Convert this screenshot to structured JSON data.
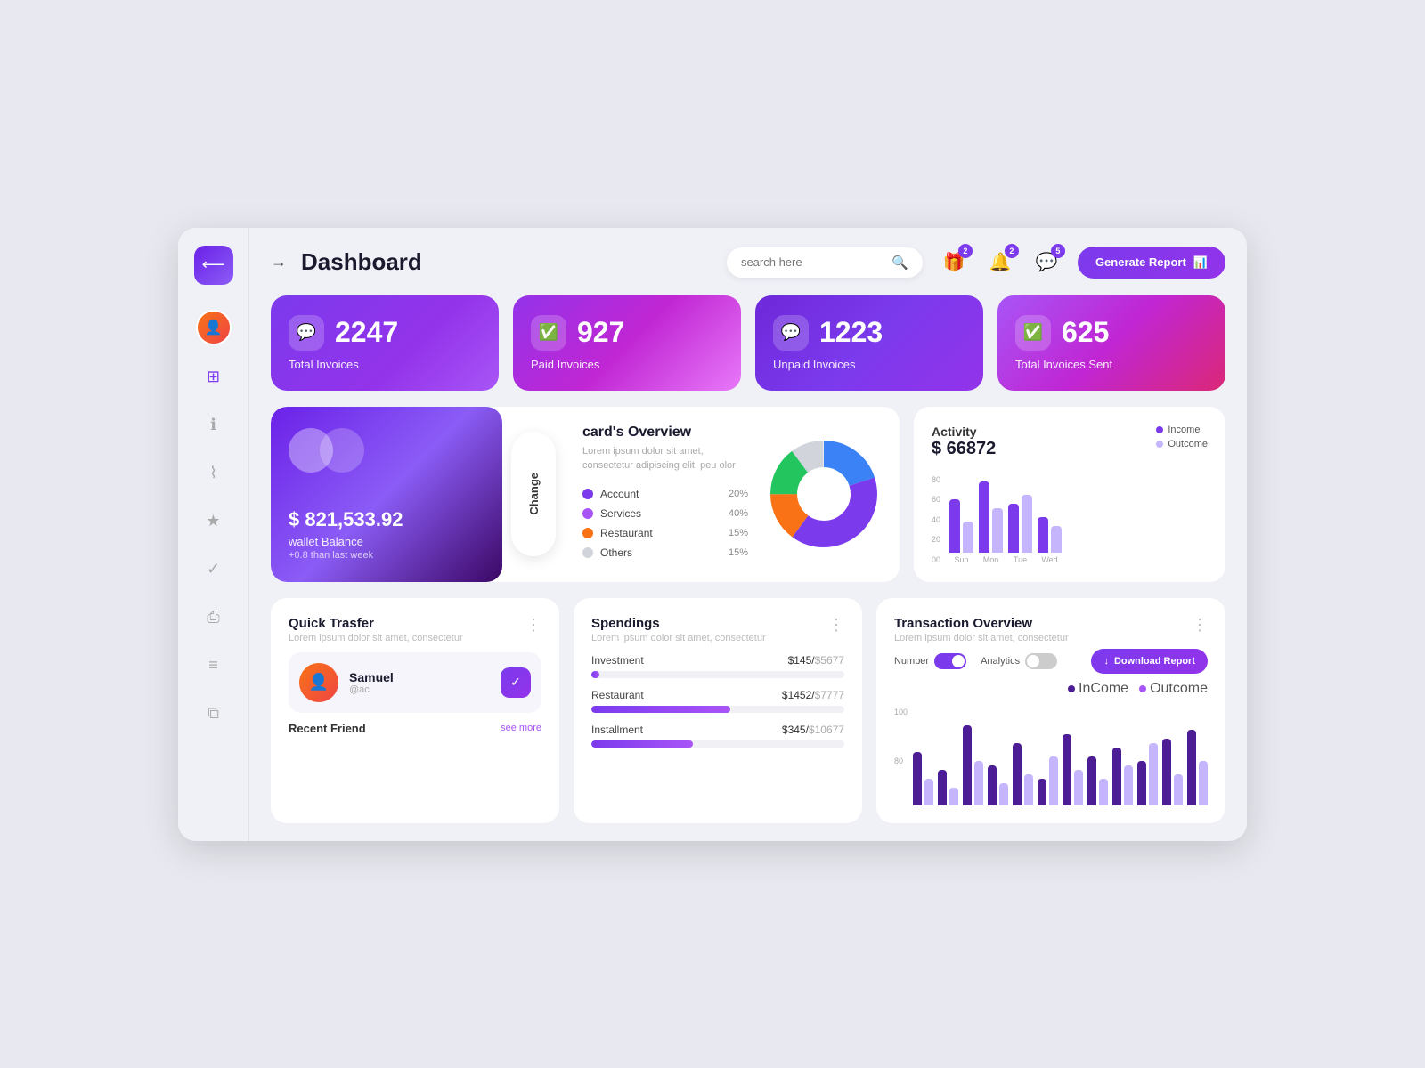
{
  "app": {
    "title": "Dashboard"
  },
  "header": {
    "search_placeholder": "search here",
    "generate_report_label": "Generate Report",
    "notifications": [
      {
        "icon": "🎁",
        "count": "2"
      },
      {
        "icon": "🔔",
        "count": "2"
      },
      {
        "icon": "💬",
        "count": "5"
      }
    ]
  },
  "stat_cards": [
    {
      "id": "total-invoices",
      "number": "2247",
      "label": "Total Invoices",
      "icon": "💬"
    },
    {
      "id": "paid-invoices",
      "number": "927",
      "label": "Paid Invoices",
      "icon": "✅"
    },
    {
      "id": "unpaid-invoices",
      "number": "1223",
      "label": "Unpaid Invoices",
      "icon": "💬"
    },
    {
      "id": "sent-invoices",
      "number": "625",
      "label": "Total Invoices Sent",
      "icon": "✅"
    }
  ],
  "card_overview": {
    "title": "card's Overview",
    "subtitle": "Lorem ipsum dolor sit amet, consectetur adipiscing elit, peu olor",
    "amount": "$ 821,533.92",
    "wallet_label": "wallet Balance",
    "wallet_change": "+0.8 than last week",
    "change_btn": "Change",
    "legend": [
      {
        "label": "Account",
        "color": "#7C3AED",
        "pct": "20%"
      },
      {
        "label": "Services",
        "color": "#A855F7",
        "pct": "40%"
      },
      {
        "label": "Restaurant",
        "color": "#F97316",
        "pct": "15%"
      },
      {
        "label": "Others",
        "color": "#D1D5DB",
        "pct": "15%"
      }
    ]
  },
  "activity": {
    "title": "Activity",
    "amount": "$ 66872",
    "income_label": "Income",
    "outcome_label": "Outcome",
    "y_axis": [
      "80",
      "60",
      "40",
      "20",
      "00"
    ],
    "bars": [
      {
        "day": "Sun",
        "income": 60,
        "outcome": 35
      },
      {
        "day": "Mon",
        "income": 80,
        "outcome": 50
      },
      {
        "day": "Tue",
        "income": 55,
        "outcome": 65
      },
      {
        "day": "Wed",
        "income": 40,
        "outcome": 30
      }
    ]
  },
  "quick_transfer": {
    "title": "Quick Trasfer",
    "subtitle": "Lorem ipsum dolor sit amet, consectetur",
    "user": {
      "name": "Samuel",
      "handle": "@ac"
    },
    "recent_label": "Recent Friend",
    "see_more": "see more"
  },
  "spendings": {
    "title": "Spendings",
    "subtitle": "Lorem ipsum dolor sit amet, consectetur",
    "items": [
      {
        "label": "Investment",
        "current": "$145",
        "max": "$5677",
        "pct": 3
      },
      {
        "label": "Restaurant",
        "current": "$1452",
        "max": "$7777",
        "pct": 55
      },
      {
        "label": "Installment",
        "current": "$345",
        "max": "$10677",
        "pct": 40
      }
    ]
  },
  "transaction_overview": {
    "title": "Transaction Overview",
    "subtitle": "Lorem ipsum dolor sit amet, consectetur",
    "download_label": "Download Report",
    "number_label": "Number",
    "analytics_label": "Analytics",
    "income_label": "InCome",
    "outcome_label": "Outcome",
    "y_axis": [
      "100",
      "80"
    ],
    "bars": [
      {
        "income": 60,
        "outcome": 30
      },
      {
        "income": 40,
        "outcome": 20
      },
      {
        "income": 90,
        "outcome": 50
      },
      {
        "income": 45,
        "outcome": 25
      },
      {
        "income": 70,
        "outcome": 35
      },
      {
        "income": 30,
        "outcome": 55
      },
      {
        "income": 80,
        "outcome": 40
      },
      {
        "income": 55,
        "outcome": 30
      },
      {
        "income": 65,
        "outcome": 45
      },
      {
        "income": 50,
        "outcome": 70
      },
      {
        "income": 75,
        "outcome": 35
      },
      {
        "income": 85,
        "outcome": 50
      }
    ]
  },
  "sidebar": {
    "items": [
      {
        "icon": "◈",
        "label": "dashboard",
        "active": true
      },
      {
        "icon": "ℹ",
        "label": "info"
      },
      {
        "icon": "〜",
        "label": "analytics"
      },
      {
        "icon": "★",
        "label": "favorites"
      },
      {
        "icon": "✓",
        "label": "check"
      },
      {
        "icon": "🖨",
        "label": "print"
      },
      {
        "icon": "≡",
        "label": "menu"
      },
      {
        "icon": "⧉",
        "label": "layers"
      }
    ]
  },
  "colors": {
    "primary": "#7C3AED",
    "income": "#4C1D95",
    "outcome": "#C4B5FD",
    "pie_account": "#3B82F6",
    "pie_services": "#7C3AED",
    "pie_restaurant": "#F97316",
    "pie_others": "#D1D5DB",
    "pie_green": "#22C55E"
  }
}
